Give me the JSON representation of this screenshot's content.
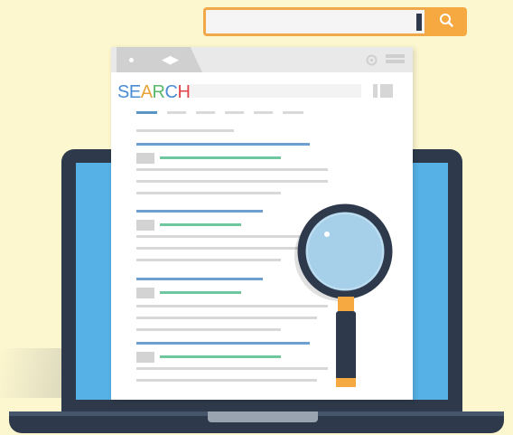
{
  "top_search": {
    "value": "",
    "button_icon": "search-icon",
    "border_color": "#f1a849",
    "button_color": "#f6a940"
  },
  "browser": {
    "logo_letters": [
      {
        "char": "S",
        "color": "#4a8cd6"
      },
      {
        "char": "E",
        "color": "#4a8cd6"
      },
      {
        "char": "A",
        "color": "#e9a33a"
      },
      {
        "char": "R",
        "color": "#58b96a"
      },
      {
        "char": "C",
        "color": "#4a8cd6"
      },
      {
        "char": "H",
        "color": "#e0454b"
      }
    ],
    "nav_arrows": "◀▶",
    "settings_icon": "gear-icon",
    "menu_icon": "hamburger-icon"
  },
  "laptop": {
    "bezel_color": "#2e3a4b",
    "screen_color": "#55b1e6"
  },
  "magnifier_icon": "magnifying-glass-icon",
  "colors": {
    "background": "#fdf7cf",
    "result_title": "#6f9fcf",
    "result_url": "#6fc7a0",
    "result_text": "#d8d8d8"
  }
}
